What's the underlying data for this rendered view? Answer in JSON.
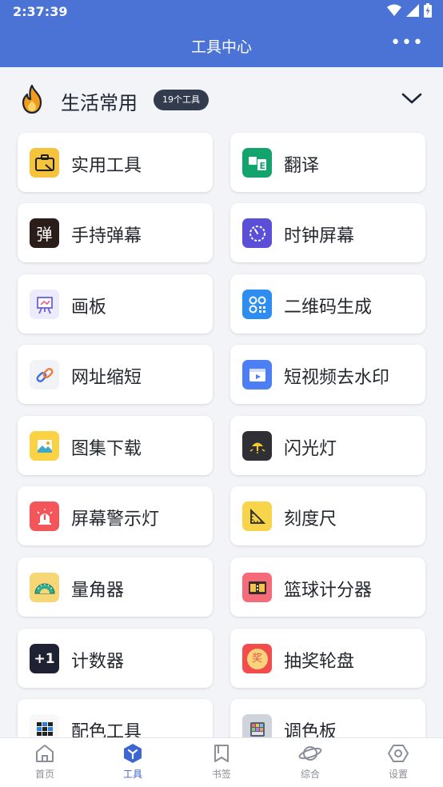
{
  "status": {
    "time": "2:37:39"
  },
  "app": {
    "title": "工具中心",
    "more_label": "•••"
  },
  "section": {
    "title": "生活常用",
    "badge": "19个工具"
  },
  "tools": [
    {
      "label": "实用工具",
      "icon": "toolbox-icon",
      "color": "#f6c33c"
    },
    {
      "label": "翻译",
      "icon": "translate-icon",
      "color": "#13a36d"
    },
    {
      "label": "手持弹幕",
      "icon": "danmaku-icon",
      "color": "#2a1d1a",
      "glyph": "弹"
    },
    {
      "label": "时钟屏幕",
      "icon": "clock-icon",
      "color": "#5a4fd6"
    },
    {
      "label": "画板",
      "icon": "easel-icon",
      "color": "#ecebfb"
    },
    {
      "label": "二维码生成",
      "icon": "qrcode-icon",
      "color": "#2e8df0"
    },
    {
      "label": "网址缩短",
      "icon": "link-icon",
      "color": "#f2f3f7"
    },
    {
      "label": "短视频去水印",
      "icon": "video-icon",
      "color": "#4d7ff4"
    },
    {
      "label": "图集下载",
      "icon": "gallery-icon",
      "color": "#fbd244"
    },
    {
      "label": "闪光灯",
      "icon": "flashlight-icon",
      "color": "#2e3036"
    },
    {
      "label": "屏幕警示灯",
      "icon": "alarm-icon",
      "color": "#f3555a"
    },
    {
      "label": "刻度尺",
      "icon": "ruler-icon",
      "color": "#f8d44a"
    },
    {
      "label": "量角器",
      "icon": "protractor-icon",
      "color": "#f7d675"
    },
    {
      "label": "篮球计分器",
      "icon": "scoreboard-icon",
      "color": "#f56b7a"
    },
    {
      "label": "计数器",
      "icon": "counter-icon",
      "color": "#1f2232",
      "glyph": "+1"
    },
    {
      "label": "抽奖轮盘",
      "icon": "lottery-icon",
      "color": "#f24c4c",
      "glyph": "奖"
    },
    {
      "label": "配色工具",
      "icon": "palette-grid-icon",
      "color": "#f8f8f8"
    },
    {
      "label": "调色板",
      "icon": "color-board-icon",
      "color": "#cfd3dc"
    }
  ],
  "nav": [
    {
      "label": "首页",
      "icon": "home-icon"
    },
    {
      "label": "工具",
      "icon": "tools-icon",
      "active": true
    },
    {
      "label": "书签",
      "icon": "bookmark-icon"
    },
    {
      "label": "综合",
      "icon": "planet-icon"
    },
    {
      "label": "设置",
      "icon": "settings-icon"
    }
  ]
}
